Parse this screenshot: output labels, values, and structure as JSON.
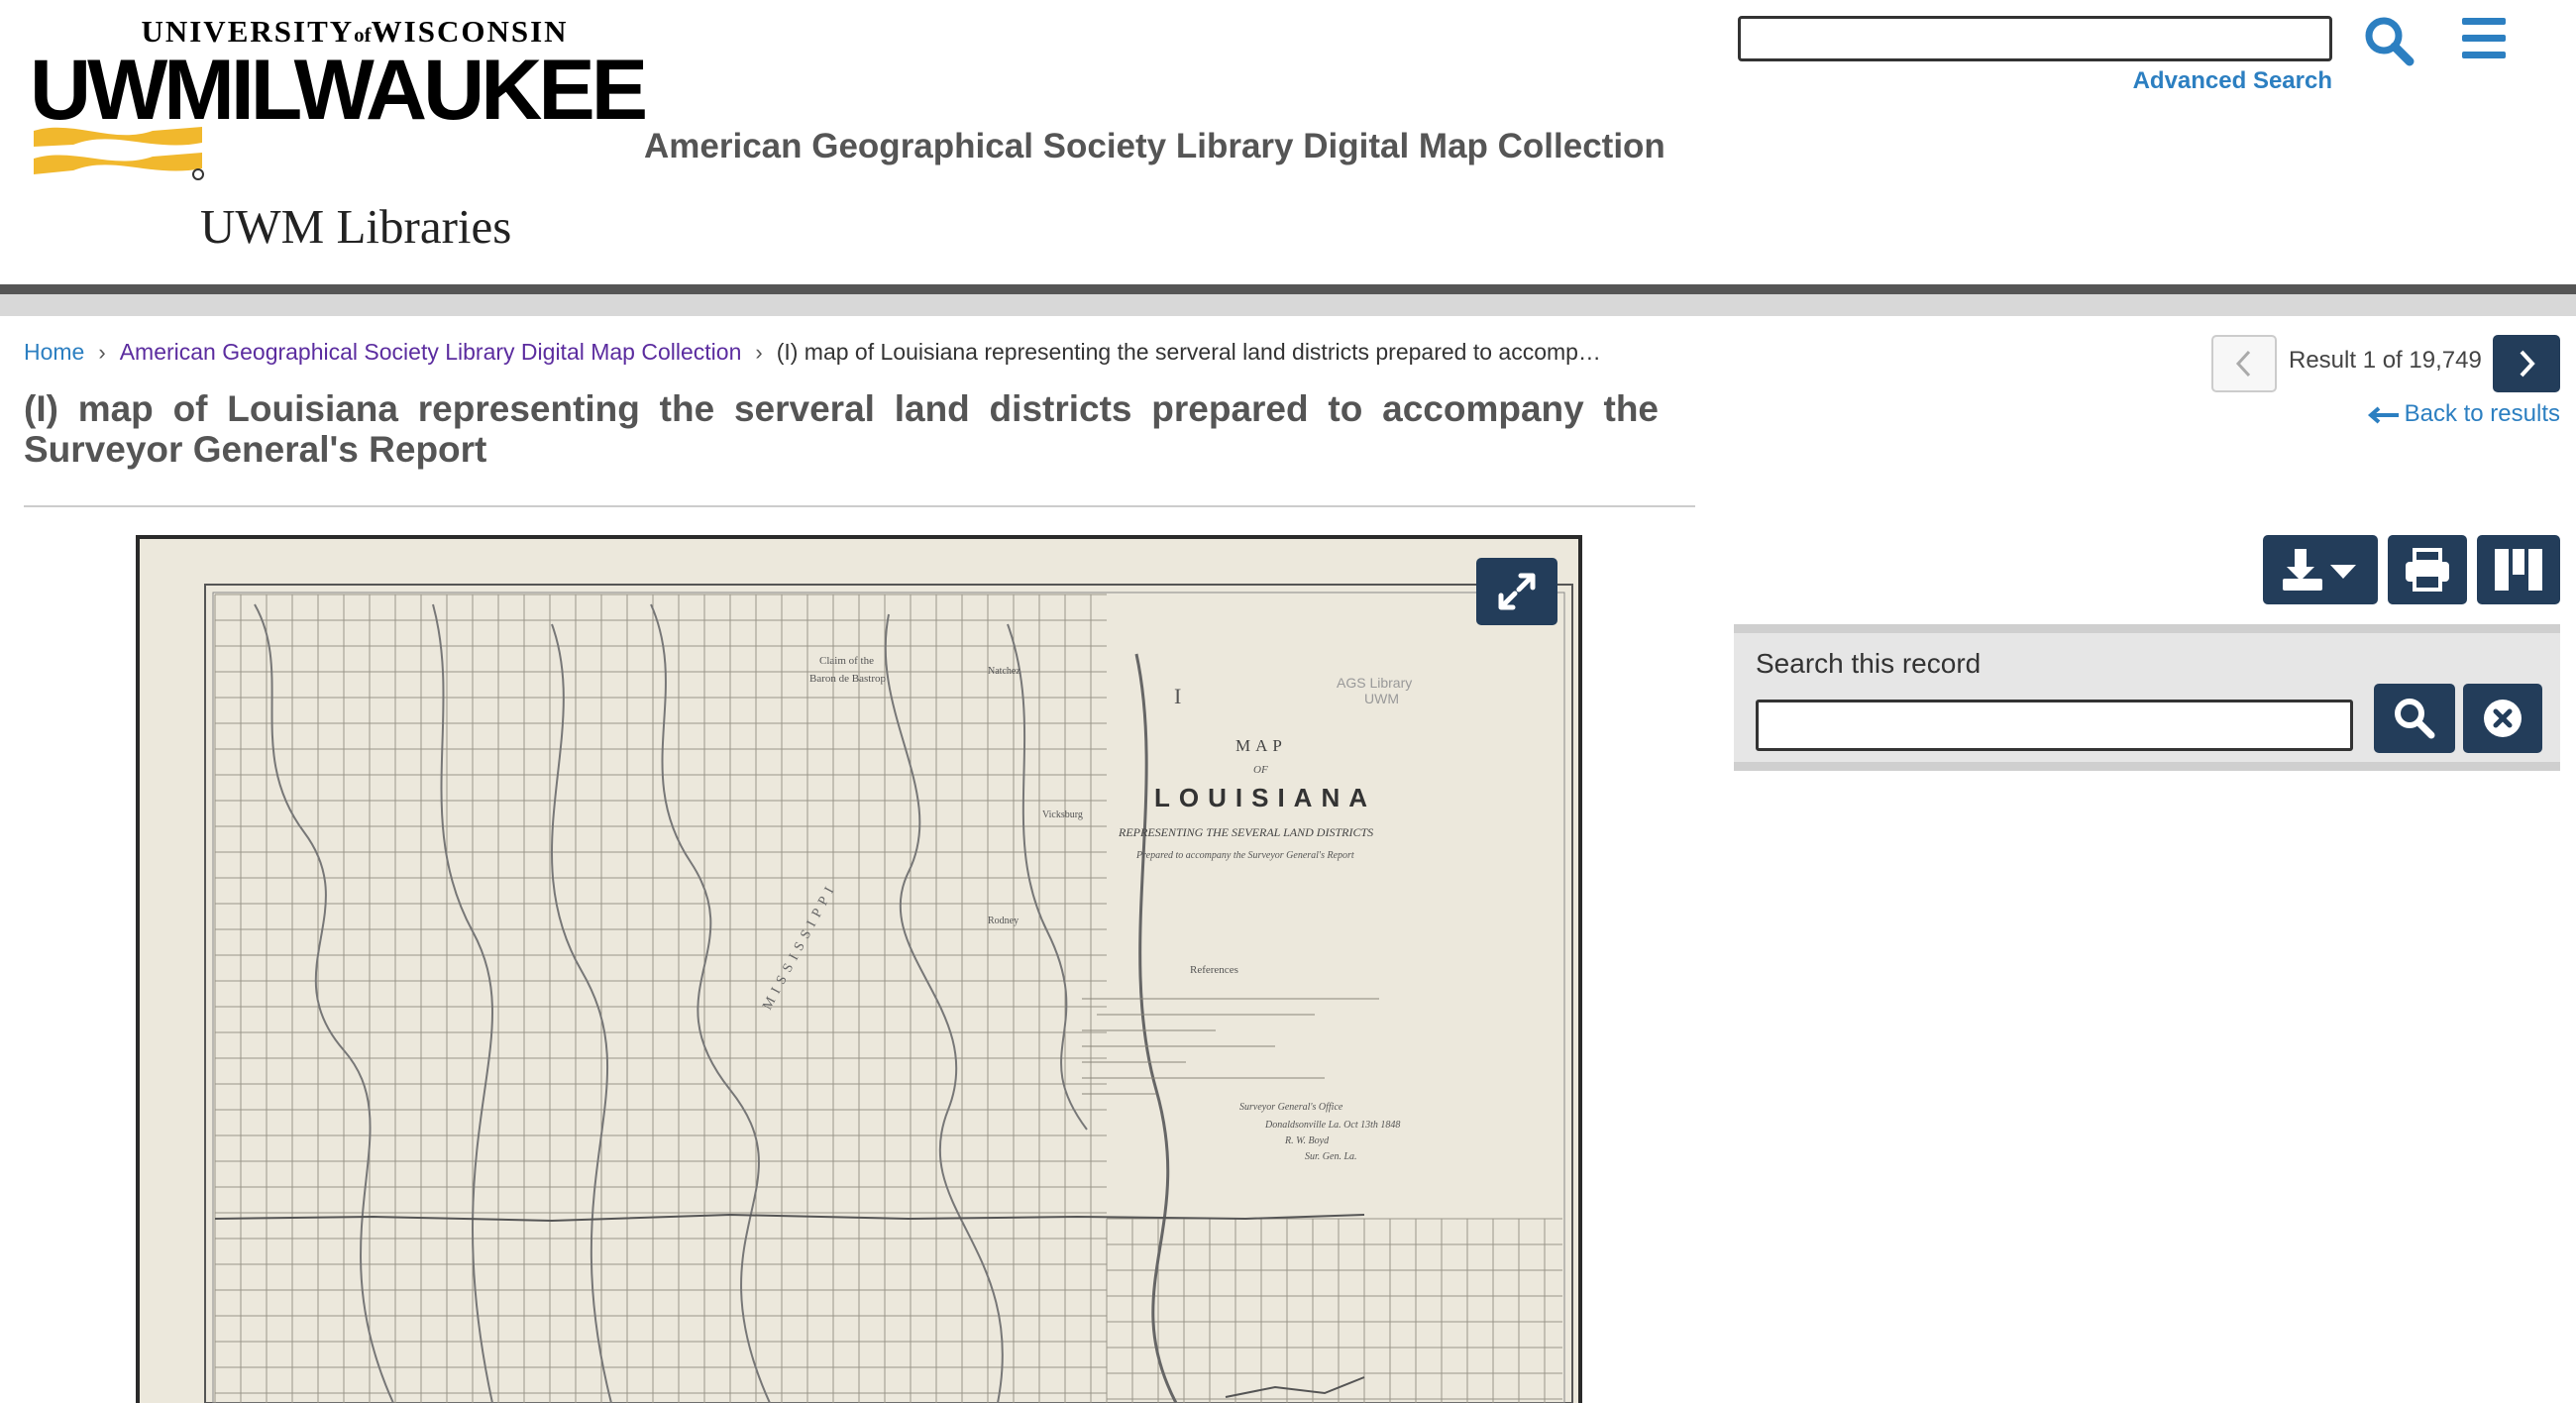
{
  "header": {
    "logo": {
      "university_line_1": "UNIVERSITY",
      "university_of": "of",
      "university_line_2": "WISCONSIN",
      "wordmark": "UWMILWAUKEE",
      "libraries": "UWM Libraries"
    },
    "site_title": "American Geographical Society Library Digital Map Collection",
    "search": {
      "value": "",
      "placeholder": ""
    },
    "advanced_search_label": "Advanced Search",
    "icons": {
      "search": "search-icon",
      "menu": "hamburger-menu-icon"
    }
  },
  "breadcrumb": {
    "home": "Home",
    "collection": "American Geographical Society Library Digital Map Collection",
    "current": "(I) map of Louisiana representing the serveral land districts prepared to accomp…"
  },
  "record": {
    "title": "(I) map of Louisiana representing the serveral land districts prepared to accompany the Surveyor General's Report"
  },
  "map_image": {
    "label_top": "Claim of the",
    "label_top_2": "Baron de Bastrop",
    "roman": "I",
    "stamp_1": "AGS Library",
    "stamp_2": "UWM",
    "map_heading": "MAP",
    "of": "OF",
    "state": "LOUISIANA",
    "subtitle": "REPRESENTING THE SEVERAL LAND DISTRICTS",
    "subtitle_2": "Prepared to accompany the Surveyor General's Report",
    "references": "References",
    "river_label": "MISSISSIPPI",
    "place_1": "Vicksburg",
    "place_2": "Rodney",
    "place_3": "Natchez",
    "signature_1": "Surveyor General's Office",
    "signature_2": "Donaldsonville La. Oct 13th 1848",
    "signature_3": "R. W. Boyd",
    "signature_4": "Sur. Gen. La."
  },
  "pager": {
    "result_text": "Result 1 of 19,749",
    "back_label": "Back to results",
    "prev_icon": "chevron-left-icon",
    "next_icon": "chevron-right-icon"
  },
  "toolbar": {
    "download_icon": "download-icon",
    "print_icon": "print-icon",
    "panels_icon": "columns-icon"
  },
  "record_search": {
    "label": "Search this record",
    "value": "",
    "placeholder": ""
  },
  "colors": {
    "primary_link": "#2c7fc1",
    "visited_link": "#5b2c9f",
    "button_navy": "#233d5a",
    "logo_gold": "#f1b82d",
    "map_paper": "#ece8dc"
  }
}
